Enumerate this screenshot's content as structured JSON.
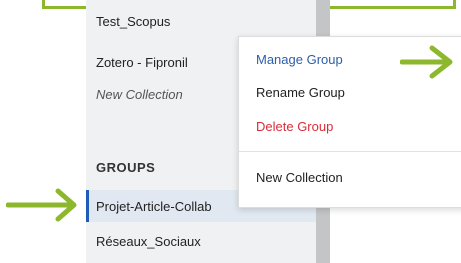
{
  "sidebar": {
    "items": [
      {
        "label": "Test_Scopus"
      },
      {
        "label": "Zotero - Fipronil"
      },
      {
        "label": "New Collection"
      }
    ],
    "groups_heading": "GROUPS",
    "groups": [
      {
        "label": "Projet-Article-Collab",
        "selected": true
      },
      {
        "label": "Réseaux_Sociaux"
      }
    ]
  },
  "context_menu": {
    "items": [
      {
        "label": "Manage Group",
        "color": "#2e5ea8"
      },
      {
        "label": "Rename Group",
        "color": "#222222"
      },
      {
        "label": "Delete Group",
        "color": "#d92d3a"
      },
      {
        "label": "New Collection",
        "color": "#222222"
      }
    ]
  },
  "annotations": {
    "arrow_color": "#8db82e",
    "arrows": [
      "arrow-right-icon",
      "arrow-right-icon"
    ]
  },
  "colors": {
    "accent": "#1d5db8",
    "highlight": "#8db82e",
    "danger": "#d92d3a"
  }
}
